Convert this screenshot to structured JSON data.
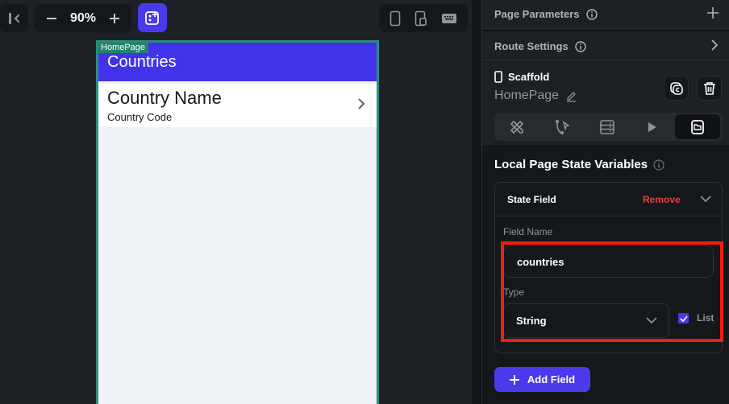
{
  "toolbar": {
    "collapse_icon": "collapse-left-icon",
    "zoom_out_icon": "minus-icon",
    "zoom_level": "90%",
    "zoom_in_icon": "plus-icon",
    "add_widget_icon": "add-widget-icon",
    "devices": [
      "phone-icon",
      "tablet-icon",
      "keyboard-icon"
    ]
  },
  "canvas": {
    "page_tag": "HomePage",
    "appbar_title": "Countries",
    "appbar_color": "#4233e8",
    "list_tile": {
      "title": "Country Name",
      "subtitle": "Country Code",
      "trailing_icon": "chevron-right-icon"
    }
  },
  "panel": {
    "page_parameters": {
      "label": "Page Parameters",
      "action_icon": "plus-icon"
    },
    "route_settings": {
      "label": "Route Settings",
      "action_icon": "chevron-right-icon"
    },
    "scaffold": {
      "type_label": "Scaffold",
      "name": "HomePage",
      "actions": [
        "duplicate-icon",
        "trash-icon"
      ]
    },
    "tabs": [
      {
        "icon": "design-tools-icon",
        "active": false
      },
      {
        "icon": "actions-flow-icon",
        "active": false
      },
      {
        "icon": "backend-query-icon",
        "active": false
      },
      {
        "icon": "play-icon",
        "active": false
      },
      {
        "icon": "page-state-icon",
        "active": true
      }
    ],
    "local_state": {
      "title": "Local Page State Variables",
      "card_title": "State Field",
      "remove_label": "Remove",
      "remove_color": "#e2403f",
      "field_name_label": "Field Name",
      "field_name_value": "countries",
      "type_label": "Type",
      "type_value": "String",
      "list_label": "List",
      "list_checked": true
    },
    "add_field_label": "Add Field"
  },
  "accent_color": "#4a3aeb",
  "highlight_color": "#f21e10"
}
